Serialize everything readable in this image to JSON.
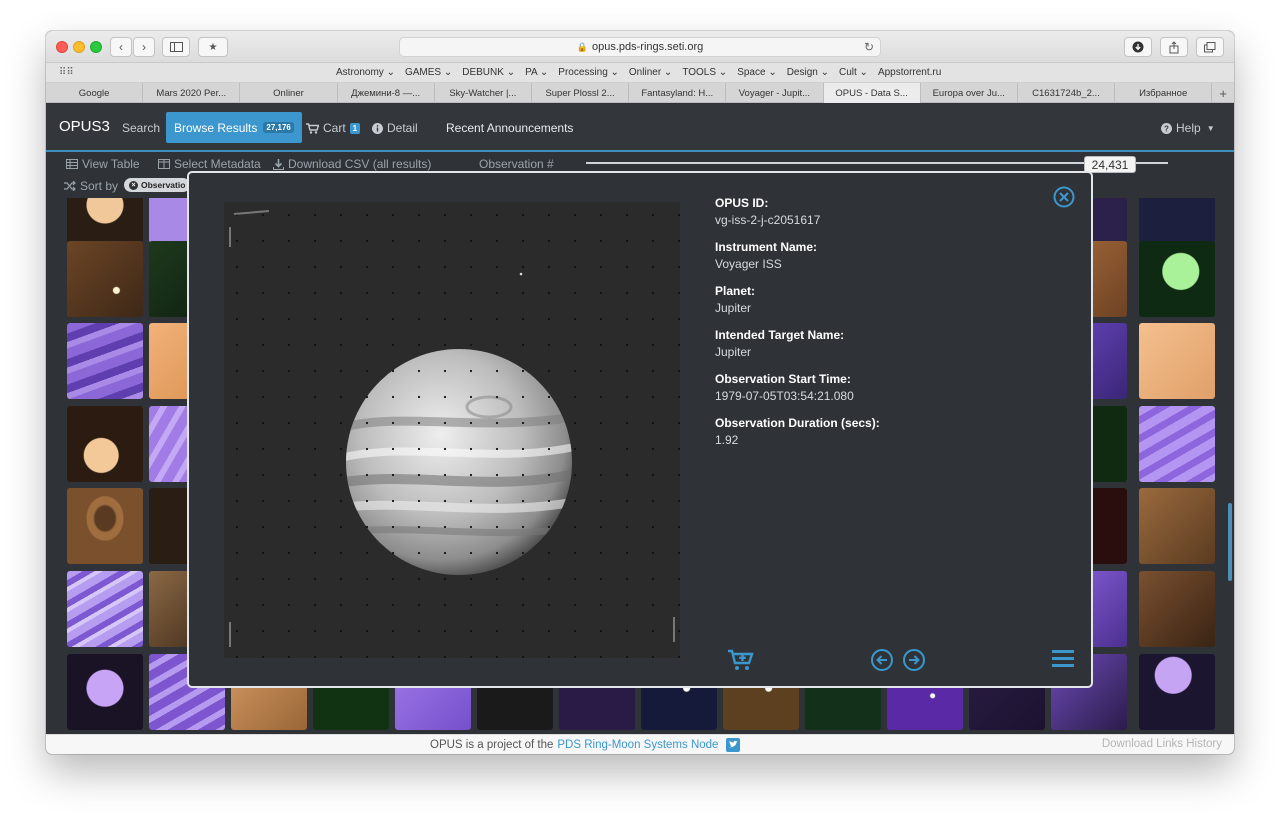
{
  "browser": {
    "url": "opus.pds-rings.seti.org",
    "bookmarks": [
      "Astronomy ⌄",
      "GAMES ⌄",
      "DEBUNK ⌄",
      "PA ⌄",
      "Processing ⌄",
      "Onliner ⌄",
      "TOOLS ⌄",
      "Space ⌄",
      "Design ⌄",
      "Cult ⌄",
      "Appstorrent.ru"
    ],
    "tabs": [
      "Google",
      "Mars 2020 Per...",
      "Onliner",
      "Джемини-8 —...",
      "Sky-Watcher |...",
      "Super Plossl 2...",
      "Fantasyland: H...",
      "Voyager - Jupit...",
      "OPUS - Data S...",
      "Europa over Ju...",
      "C1631724b_2...",
      "Избранное"
    ],
    "active_tab_index": 8
  },
  "nav": {
    "brand": "OPUS3",
    "search": "Search",
    "browse": "Browse Results",
    "browse_count": "27,176",
    "cart": "Cart",
    "cart_count": "1",
    "detail": "Detail",
    "announcements": "Recent Announcements",
    "help": "Help"
  },
  "toolbar": {
    "view_table": "View Table",
    "select_metadata": "Select Metadata",
    "download_csv": "Download CSV (all results)",
    "observation_label": "Observation #",
    "observation_value": "24,431",
    "sort_by": "Sort by",
    "sort_chip": "Observatio"
  },
  "modal": {
    "fields": [
      {
        "label": "OPUS ID:",
        "value": "vg-iss-2-j-c2051617"
      },
      {
        "label": "Instrument Name:",
        "value": "Voyager ISS"
      },
      {
        "label": "Planet:",
        "value": "Jupiter"
      },
      {
        "label": "Intended Target Name:",
        "value": "Jupiter"
      },
      {
        "label": "Observation Start Time:",
        "value": "1979-07-05T03:54:21.080"
      },
      {
        "label": "Observation Duration (secs):",
        "value": "1.92"
      }
    ]
  },
  "footer": {
    "text_prefix": "OPUS is a project of the",
    "link": "PDS Ring-Moon Systems Node",
    "right": "Download Links History"
  },
  "colors": {
    "accent": "#3b97cd",
    "nav_bg": "#33373c",
    "page_bg": "#2f3338"
  }
}
